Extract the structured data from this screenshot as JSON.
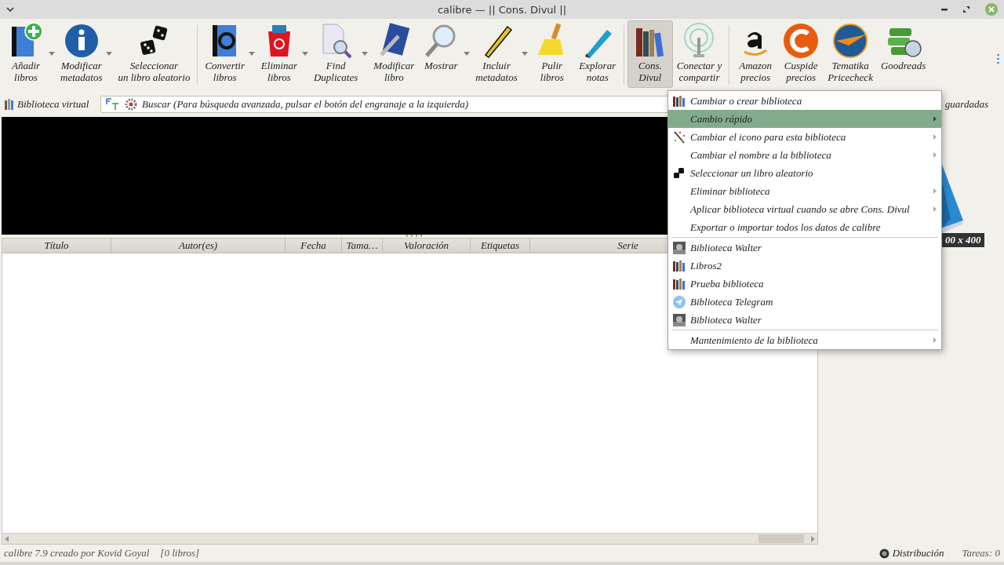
{
  "window": {
    "title": "calibre — || Cons. Divul ||"
  },
  "toolbar": {
    "groups": [
      {
        "items": [
          {
            "label": [
              "Añadir",
              "libros"
            ],
            "dropdown": true,
            "selected": false
          },
          {
            "label": [
              "Modificar",
              "metadatos"
            ],
            "dropdown": true,
            "selected": false
          },
          {
            "label": [
              "Seleccionar",
              "un libro aleatorio"
            ],
            "dropdown": false,
            "selected": false
          }
        ]
      },
      {
        "items": [
          {
            "label": [
              "Convertir",
              "libros"
            ],
            "dropdown": true,
            "selected": false
          },
          {
            "label": [
              "Eliminar",
              "libros"
            ],
            "dropdown": true,
            "selected": false
          },
          {
            "label": [
              "Find",
              "Duplicates"
            ],
            "dropdown": true,
            "selected": false
          },
          {
            "label": [
              "Modificar",
              "libro"
            ],
            "dropdown": false,
            "selected": false
          },
          {
            "label": [
              "Mostrar"
            ],
            "dropdown": true,
            "selected": false
          },
          {
            "label": [
              "Incluir",
              "metadatos"
            ],
            "dropdown": true,
            "selected": false
          },
          {
            "label": [
              "Pulir",
              "libros"
            ],
            "dropdown": false,
            "selected": false
          },
          {
            "label": [
              "Explorar",
              "notas"
            ],
            "dropdown": false,
            "selected": false
          }
        ]
      },
      {
        "items": [
          {
            "label": [
              "Cons.",
              "Divul"
            ],
            "dropdown": false,
            "selected": true
          },
          {
            "label": [
              "Conectar y",
              "compartir"
            ],
            "dropdown": false,
            "selected": false
          }
        ]
      },
      {
        "items": [
          {
            "label": [
              "Amazon",
              "precios"
            ],
            "dropdown": false,
            "selected": false
          },
          {
            "label": [
              "Cuspide",
              "precios"
            ],
            "dropdown": false,
            "selected": false
          },
          {
            "label": [
              "Tematika",
              "Pricecheck"
            ],
            "dropdown": false,
            "selected": false
          },
          {
            "label": [
              "Goodreads"
            ],
            "dropdown": false,
            "selected": false
          }
        ]
      }
    ]
  },
  "search_row": {
    "virtual_library": "Biblioteca virtual",
    "search": {
      "placeholder": "Buscar (Para búsqueda avanzada, pulsar el botón del engranaje a la izquierda)"
    },
    "saved_searches": "guardadas"
  },
  "table": {
    "columns": [
      "Título",
      "Autor(es)",
      "Fecha",
      "Tama…",
      "Valoración",
      "Etiquetas",
      "Serie"
    ]
  },
  "cover_panel": {
    "kind": "picture",
    "dimensions": "00 x 400"
  },
  "menu": {
    "sections": [
      {
        "items": [
          {
            "label": "Cambiar o crear biblioteca",
            "submenu": false,
            "selected": false
          },
          {
            "label": "Cambio rápido",
            "submenu": true,
            "selected": true
          },
          {
            "label": "Cambiar el icono para esta biblioteca",
            "submenu": true,
            "selected": false
          },
          {
            "label": "Cambiar el nombre a la biblioteca",
            "submenu": true,
            "selected": false
          },
          {
            "label": "Seleccionar un libro aleatorio",
            "submenu": false,
            "selected": false
          },
          {
            "label": "Eliminar biblioteca",
            "submenu": true,
            "selected": false
          },
          {
            "label": "Aplicar biblioteca virtual cuando se abre Cons. Divul",
            "submenu": true,
            "selected": false
          },
          {
            "label": "Exportar o importar todos los datos de calibre",
            "submenu": false,
            "selected": false
          }
        ]
      },
      {
        "items": [
          {
            "label": "Biblioteca Walter",
            "submenu": false,
            "selected": false
          },
          {
            "label": "Libros2",
            "submenu": false,
            "selected": false
          },
          {
            "label": "Prueba biblioteca",
            "submenu": false,
            "selected": false
          },
          {
            "label": "Biblioteca Telegram",
            "submenu": false,
            "selected": false
          },
          {
            "label": "Biblioteca Walter",
            "submenu": false,
            "selected": false
          }
        ]
      },
      {
        "items": [
          {
            "label": "Mantenimiento de la biblioteca",
            "submenu": true,
            "selected": false
          }
        ]
      }
    ]
  },
  "status_bar": {
    "version": "calibre 7.9 creado por Kovid Goyal",
    "count": "[0 libros]",
    "layout": "Distribución",
    "jobs": "Tareas: 0"
  }
}
